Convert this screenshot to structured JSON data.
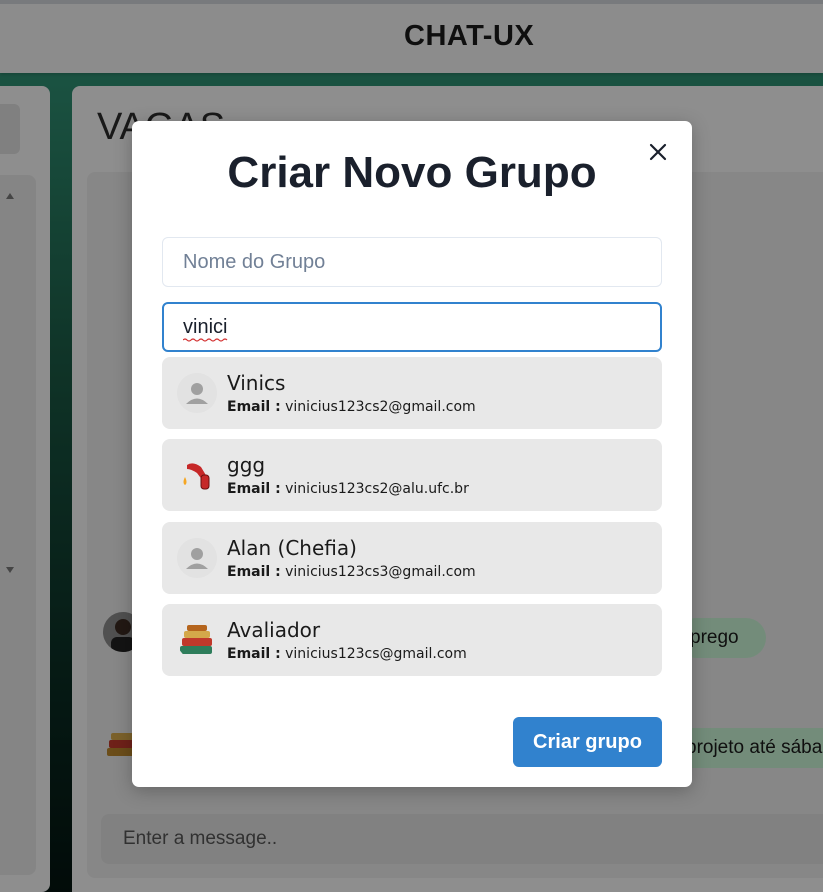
{
  "app": {
    "title": "CHAT-UX"
  },
  "chat": {
    "title": "VAGAS",
    "messages": [
      {
        "text": "prego"
      },
      {
        "text": "projeto até sába"
      }
    ],
    "input_placeholder": "Enter a message.."
  },
  "modal": {
    "title": "Criar Novo Grupo",
    "group_name_placeholder": "Nome do Grupo",
    "search_value": "vinici",
    "email_label": "Email :",
    "results": [
      {
        "name": "Vinics",
        "email": "vinicius123cs2@gmail.com",
        "avatar": "default-user-icon"
      },
      {
        "name": "ggg",
        "email": "vinicius123cs2@alu.ufc.br",
        "avatar": "fuel-pump-icon"
      },
      {
        "name": "Alan (Chefia)",
        "email": "vinicius123cs3@gmail.com",
        "avatar": "default-user-icon"
      },
      {
        "name": "Avaliador",
        "email": "vinicius123cs@gmail.com",
        "avatar": "books-icon"
      }
    ],
    "create_button": "Criar grupo"
  },
  "colors": {
    "primary": "#3182ce",
    "bubble": "#c6f2d3",
    "list_item": "#e8e8e8"
  }
}
